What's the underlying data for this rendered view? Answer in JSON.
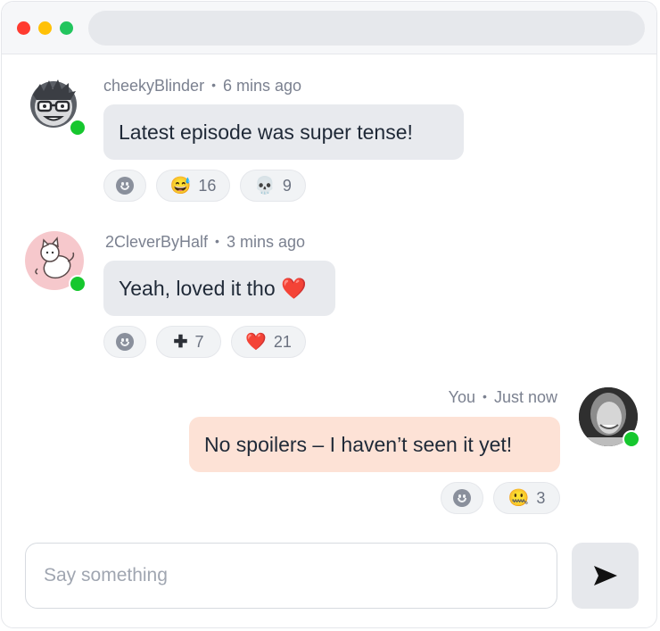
{
  "window": {
    "colors": {
      "close": "#ff3b30",
      "minimize": "#ffc107",
      "maximize": "#22c55e"
    }
  },
  "messages": [
    {
      "author": "cheekyBlinder",
      "time": "6 mins ago",
      "text": "Latest episode was super tense!",
      "online": true,
      "reactions": [
        {
          "emoji": "😅",
          "count": "16"
        },
        {
          "emoji": "💀",
          "count": "9"
        }
      ]
    },
    {
      "author": "2CleverByHalf",
      "time": "3 mins ago",
      "text": "Yeah, loved it tho ❤️",
      "online": true,
      "reactions": [
        {
          "emoji": "✚",
          "count": "7"
        },
        {
          "emoji": "❤️",
          "count": "21"
        }
      ]
    },
    {
      "author": "You",
      "time": "Just now",
      "text": "No spoilers – I haven’t seen it yet!",
      "online": true,
      "reactions": [
        {
          "emoji": "🤐",
          "count": "3"
        }
      ]
    }
  ],
  "separator": "•",
  "composer": {
    "placeholder": "Say something",
    "value": ""
  },
  "colors": {
    "online": "#16c72e",
    "incoming_bubble": "#e8eaee",
    "outgoing_bubble": "#fde2d6"
  }
}
